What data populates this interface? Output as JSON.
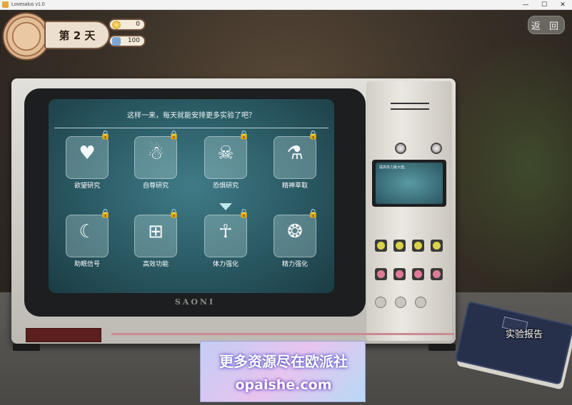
{
  "window": {
    "title": "Lovesalus v1.0",
    "controls": [
      "—",
      "☐",
      "✕"
    ]
  },
  "hud": {
    "day_label": "第 2 天",
    "gold": "0",
    "energy": "100"
  },
  "back_label": "返 回",
  "screen": {
    "title": "这样一来，每天就能安排更多实验了吧？",
    "tiles": [
      {
        "label": "欲望研究",
        "icon": "heart-icon",
        "glyph": "♥"
      },
      {
        "label": "自尊研究",
        "icon": "figures-icon",
        "glyph": "☃"
      },
      {
        "label": "恐惧研究",
        "icon": "ghost-icon",
        "glyph": "☠"
      },
      {
        "label": "精神萃取",
        "icon": "flask-icon",
        "glyph": "⚗"
      },
      {
        "label": "助眠信号",
        "icon": "moon-icon",
        "glyph": "☾"
      },
      {
        "label": "高效功能",
        "icon": "battery-icon",
        "glyph": "⊞"
      },
      {
        "label": "体力强化",
        "icon": "strongman-icon",
        "glyph": "☥"
      },
      {
        "label": "精力强化",
        "icon": "brain-icon",
        "glyph": "❂"
      }
    ],
    "selected_index": 6
  },
  "side_screen": {
    "text": "提高体力最大值。"
  },
  "brand": "SAONI",
  "report_label": "实验报告",
  "watermark": {
    "line1": "更多资源尽在欧派社",
    "line2": "opaishe.com"
  }
}
